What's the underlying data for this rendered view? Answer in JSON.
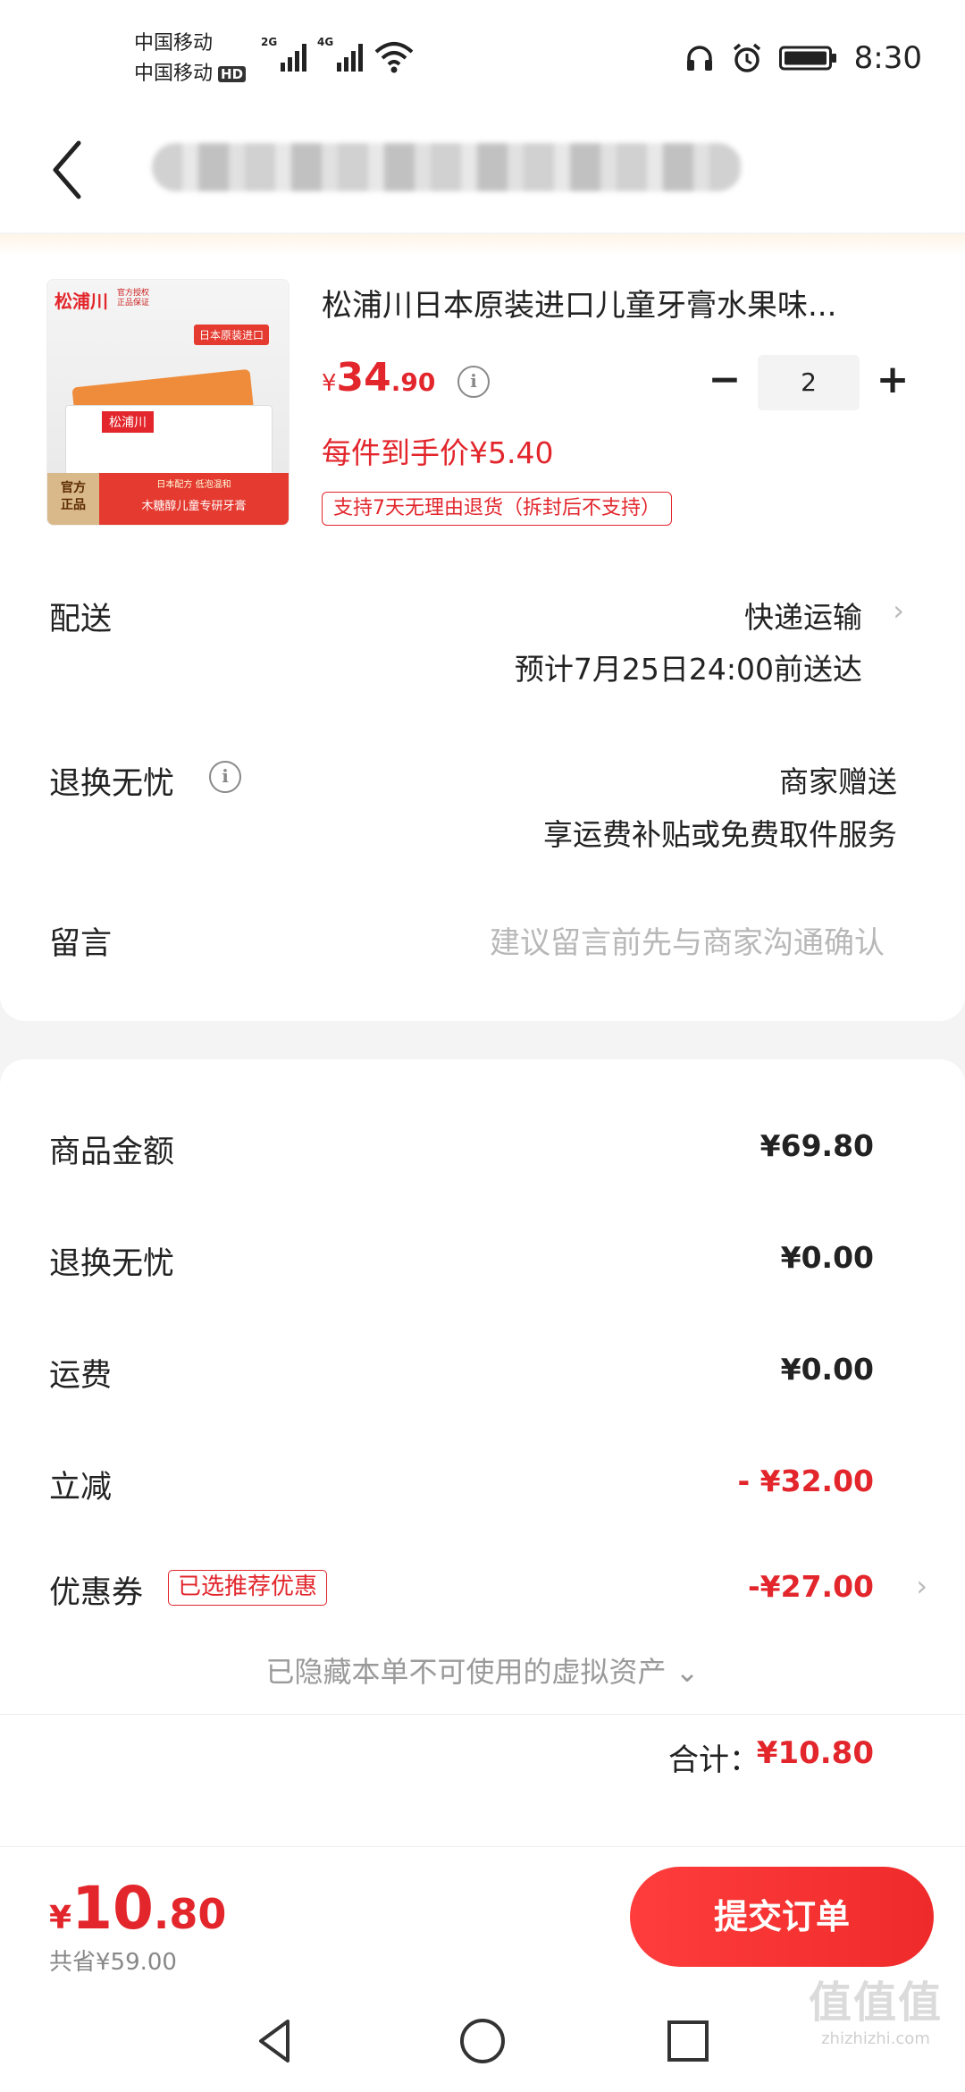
{
  "status_bar": {
    "carrier_1": "中国移动",
    "carrier_2": "中国移动",
    "hd": "HD",
    "net_1": "2G",
    "net_2": "4G",
    "time": "8:30"
  },
  "product": {
    "title": "松浦川日本原装进口儿童牙膏水果味...",
    "price_currency": "¥",
    "price_int": "34",
    "price_dec": ".90",
    "quantity": "2",
    "minus": "−",
    "plus": "+",
    "unit_price": "每件到手价¥5.40",
    "return_tag": "支持7天无理由退货（拆封后不支持）",
    "image_text": {
      "brand": "松浦川",
      "brand_sub": "官方授权\n正品保证",
      "import_badge": "日本原装进口",
      "box_brand": "松浦川",
      "official": "官方\n正品",
      "band_line1": "日本配方  低泡温和",
      "band_line2": "木糖醇儿童专研牙膏"
    }
  },
  "delivery": {
    "label": "配送",
    "method": "快递运输",
    "eta": "预计7月25日24:00前送达"
  },
  "worry_free": {
    "label": "退换无忧",
    "value": "商家赠送",
    "desc": "享运费补贴或免费取件服务"
  },
  "message": {
    "label": "留言",
    "placeholder": "建议留言前先与商家沟通确认"
  },
  "summary": {
    "goods_label": "商品金额",
    "goods_value": "¥69.80",
    "worry_label": "退换无忧",
    "worry_value": "¥0.00",
    "shipping_label": "运费",
    "shipping_value": "¥0.00",
    "discount_label": "立减",
    "discount_value": "- ¥32.00",
    "coupon_label": "优惠券",
    "coupon_tag": "已选推荐优惠",
    "coupon_value": "-¥27.00",
    "hidden_note": "已隐藏本单不可使用的虚拟资产 ⌄",
    "total_label": "合计：",
    "total_value": "¥10.80"
  },
  "bottom": {
    "currency": "¥",
    "price_int": "10",
    "price_dec": ".80",
    "saved": "共省¥59.00",
    "submit": "提交订单"
  },
  "watermark": {
    "big": "值值值",
    "small": "zhizhizhi.com"
  },
  "colors": {
    "accent": "#e2262c",
    "submit_button": "#ff3d3d"
  }
}
